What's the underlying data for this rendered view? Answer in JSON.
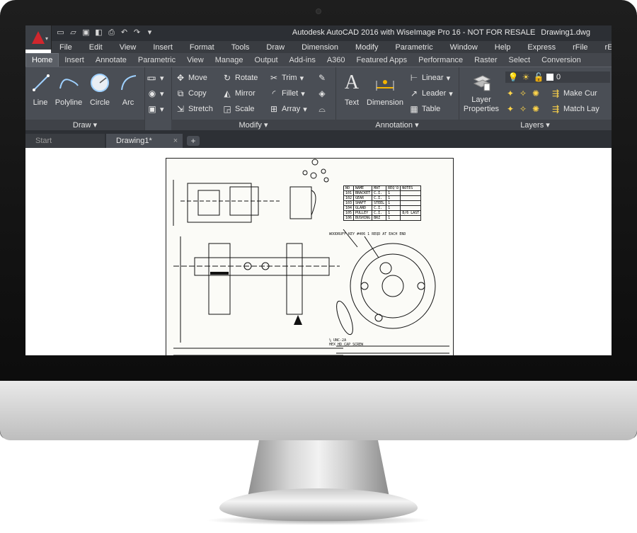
{
  "titlebar": {
    "title": "Autodesk AutoCAD 2016 with WiseImage Pro 16 - NOT FOR RESALE",
    "document": "Drawing1.dwg",
    "qat_icons": [
      "new-icon",
      "open-icon",
      "save-icon",
      "saveas-icon",
      "print-icon",
      "undo-icon",
      "redo-icon",
      "customize-icon"
    ]
  },
  "menubar": [
    "File",
    "Edit",
    "View",
    "Insert",
    "Format",
    "Tools",
    "Draw",
    "Dimension",
    "Modify",
    "Parametric",
    "Window",
    "Help",
    "Express",
    "rFile",
    "rEdit"
  ],
  "ribbon_tabs": [
    "Home",
    "Insert",
    "Annotate",
    "Parametric",
    "View",
    "Manage",
    "Output",
    "Add-ins",
    "A360",
    "Featured Apps",
    "Performance",
    "Raster",
    "Select",
    "Conversion"
  ],
  "active_tab": "Home",
  "panels": {
    "draw": {
      "title": "Draw",
      "tools": [
        "Line",
        "Polyline",
        "Circle",
        "Arc"
      ]
    },
    "modify": {
      "title": "Modify",
      "tools": [
        "Move",
        "Rotate",
        "Trim",
        "Copy",
        "Mirror",
        "Fillet",
        "Stretch",
        "Scale",
        "Array"
      ]
    },
    "annotation": {
      "title": "Annotation",
      "text": "Text",
      "dimension": "Dimension",
      "linear": "Linear",
      "leader": "Leader",
      "table": "Table"
    },
    "layers": {
      "title": "Layers",
      "layer_properties": "Layer Properties",
      "current_layer": "0",
      "make_current": "Make Cur",
      "match_layer": "Match Lay"
    }
  },
  "doc_tabs": {
    "start": "Start",
    "drawing": "Drawing1*"
  },
  "parts_table": {
    "headers": [
      "NO",
      "NAME",
      "MAT",
      "REQ'D",
      "NOTES"
    ],
    "rows": [
      [
        "101",
        "BRACKET",
        "C.I.",
        "1",
        ""
      ],
      [
        "102",
        "GEAR",
        "C.I.",
        "1",
        ""
      ],
      [
        "103",
        "SHAFT",
        "STEEL",
        "1",
        ""
      ],
      [
        "104",
        "GLAND",
        "C.I.",
        "1",
        ""
      ],
      [
        "105",
        "PULLEY",
        "C.I.",
        "1",
        "8/6 LAST"
      ],
      [
        "106",
        "BUSHING",
        "BRZ",
        "1",
        ""
      ]
    ]
  },
  "drawing_notes": {
    "woodruff": "WOODRUFF KEY #406 1 REQD AT EACH END",
    "hex": "HEX HD CAP SCREW",
    "unc": "¼ UNC-2A"
  },
  "colors": {
    "accent": "#d0262d",
    "ribbon": "#4a4e55",
    "titlebar": "#2c2f34"
  }
}
